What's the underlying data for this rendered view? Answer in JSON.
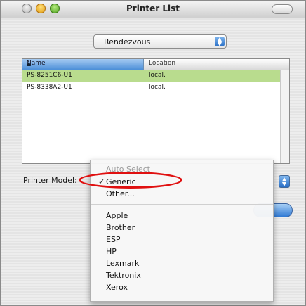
{
  "window": {
    "title": "Printer List"
  },
  "discovery_popup": {
    "value": "Rendezvous"
  },
  "table": {
    "columns": [
      "Name",
      "Location"
    ],
    "rows": [
      {
        "name": "PS-8251C6-U1",
        "location": "local."
      },
      {
        "name": "PS-8338A2-U1",
        "location": "local."
      }
    ]
  },
  "printer_model": {
    "label": "Printer Model:"
  },
  "menu": {
    "items": [
      {
        "label": "Auto Select",
        "disabled": true
      },
      {
        "label": "Generic",
        "checked": true
      },
      {
        "label": "Other..."
      },
      {
        "label": "Apple"
      },
      {
        "label": "Brother"
      },
      {
        "label": "ESP"
      },
      {
        "label": "HP"
      },
      {
        "label": "Lexmark"
      },
      {
        "label": "Tektronix"
      },
      {
        "label": "Xerox"
      }
    ]
  },
  "icons": {
    "close": "close-button-icon",
    "minimize": "minimize-button-icon",
    "zoom": "zoom-button-icon",
    "popup": "popup-arrows-icon",
    "checkmark": "checkmark-icon"
  },
  "colors": {
    "selection_row": "#b9dc8e",
    "header_blue": "#4c8fd8",
    "annotation_red": "#e01010"
  }
}
